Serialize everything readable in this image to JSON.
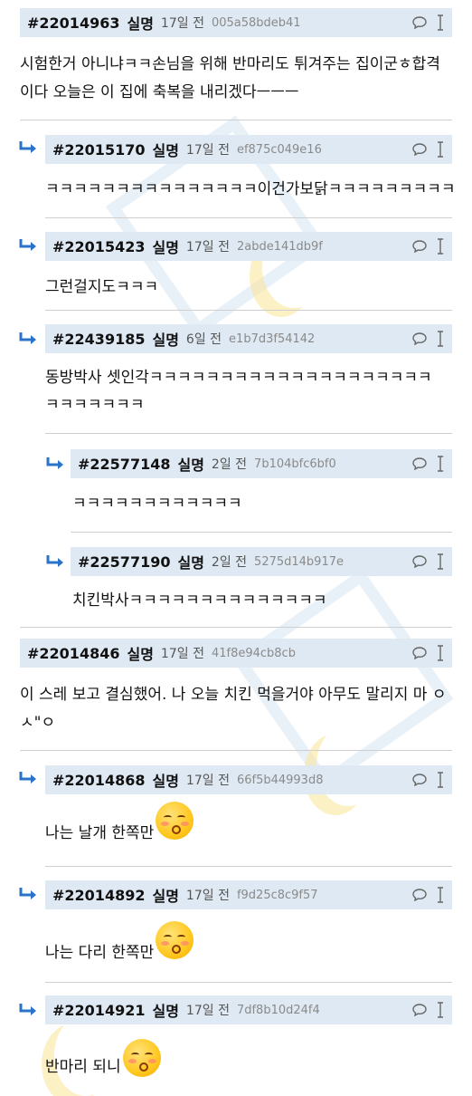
{
  "comments": [
    {
      "id": "#22014963",
      "author": "실명",
      "date": "17일 전",
      "hash": "005a58bdeb41",
      "lines": [
        "시험한거 아니냐ㅋㅋ손님을 위해 반마리도 튀겨주는 집이군ㅎ합격",
        "이다 오늘은 이 집에 축복을 내리겠다ㅡㅡㅡ"
      ]
    },
    {
      "id": "#22015170",
      "author": "실명",
      "date": "17일 전",
      "hash": "ef875c049e16",
      "lines": [
        "ㅋㅋㅋㅋㅋㅋㅋㅋㅋㅋㅋㅋㅋㅋㅋ이건가보닭ㅋㅋㅋㅋㅋㅋㅋㅋㅋ"
      ]
    },
    {
      "id": "#22015423",
      "author": "실명",
      "date": "17일 전",
      "hash": "2abde141db9f",
      "lines": [
        "그런걸지도ㅋㅋㅋ"
      ]
    },
    {
      "id": "#22439185",
      "author": "실명",
      "date": "6일 전",
      "hash": "e1b7d3f54142",
      "lines": [
        "동방박사 셋인각ㅋㅋㅋㅋㅋㅋㅋㅋㅋㅋㅋㅋㅋㅋㅋㅋㅋㅋㅋㅋ",
        "ㅋㅋㅋㅋㅋㅋㅋ"
      ]
    },
    {
      "id": "#22577148",
      "author": "실명",
      "date": "2일 전",
      "hash": "7b104bfc6bf0",
      "lines": [
        "ㅋㅋㅋㅋㅋㅋㅋㅋㅋㅋㅋㅋ"
      ]
    },
    {
      "id": "#22577190",
      "author": "실명",
      "date": "2일 전",
      "hash": "5275d14b917e",
      "lines": [
        "치킨박사ㅋㅋㅋㅋㅋㅋㅋㅋㅋㅋㅋㅋㅋㅋ"
      ]
    },
    {
      "id": "#22014846",
      "author": "실명",
      "date": "17일 전",
      "hash": "41f8e94cb8cb",
      "lines": [
        "이 스레 보고 결심했어. 나 오늘 치킨 먹을거야 아무도 말리지 마 ㅇ",
        "ㅅ\"ㅇ"
      ]
    },
    {
      "id": "#22014868",
      "author": "실명",
      "date": "17일 전",
      "hash": "66f5b44993d8",
      "lines": [
        "나는 날개 한쪽만"
      ]
    },
    {
      "id": "#22014892",
      "author": "실명",
      "date": "17일 전",
      "hash": "f9d25c8c9f57",
      "lines": [
        "나는 다리 한쪽만"
      ]
    },
    {
      "id": "#22014921",
      "author": "실명",
      "date": "17일 전",
      "hash": "7df8b10d24f4",
      "lines": [
        "반마리 되니"
      ]
    }
  ],
  "icons": {
    "reply": "speech-bubble-icon",
    "more": "vertical-ellipsis-icon",
    "reply_arrow": "reply-arrow-icon",
    "emoji": "kissing-face-emoji-icon"
  },
  "colors": {
    "header_bg": "#dfe9f3",
    "arrow": "#2a73c9",
    "hash": "#8a8a8a"
  }
}
